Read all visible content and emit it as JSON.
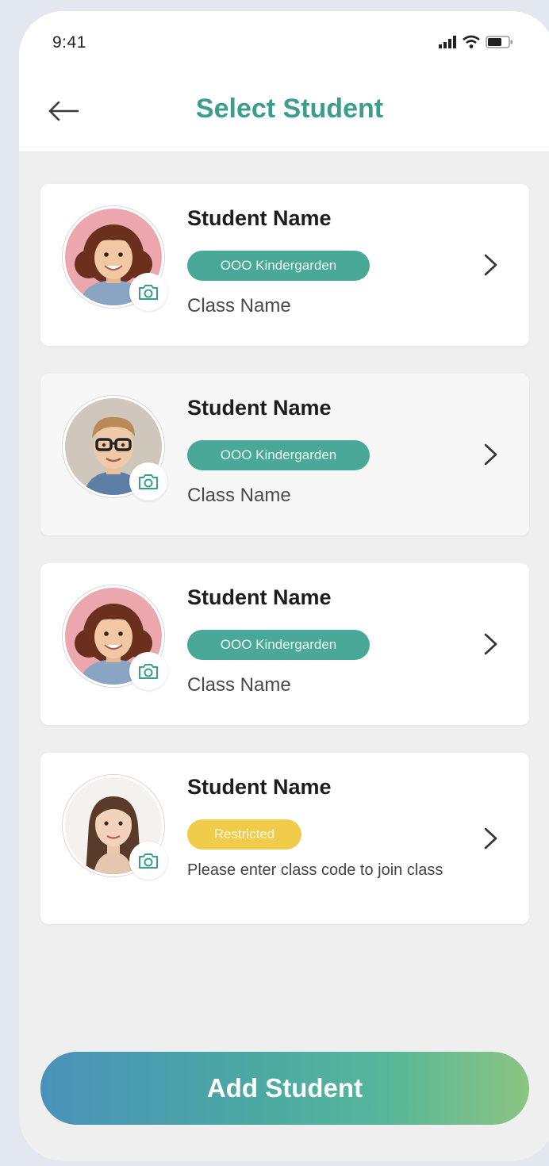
{
  "status_bar": {
    "time": "9:41"
  },
  "header": {
    "title": "Select Student",
    "back_icon": "arrow-left-icon"
  },
  "students": [
    {
      "name": "Student Name",
      "badge": "OOO Kindergarden",
      "badge_type": "teal",
      "detail": "Class Name"
    },
    {
      "name": "Student Name",
      "badge": "OOO Kindergarden",
      "badge_type": "teal",
      "detail": "Class Name"
    },
    {
      "name": "Student Name",
      "badge": "OOO Kindergarden",
      "badge_type": "teal",
      "detail": "Class Name"
    },
    {
      "name": "Student Name",
      "badge": "Restricted",
      "badge_type": "yellow",
      "detail": "Please enter class code to join class"
    }
  ],
  "actions": {
    "add_student": "Add Student"
  },
  "colors": {
    "accent": "#3b9e8d",
    "badge_teal": "#4aa898",
    "badge_yellow": "#f1cc4a",
    "gradient_start": "#4a92ba",
    "gradient_end": "#8cc482"
  }
}
